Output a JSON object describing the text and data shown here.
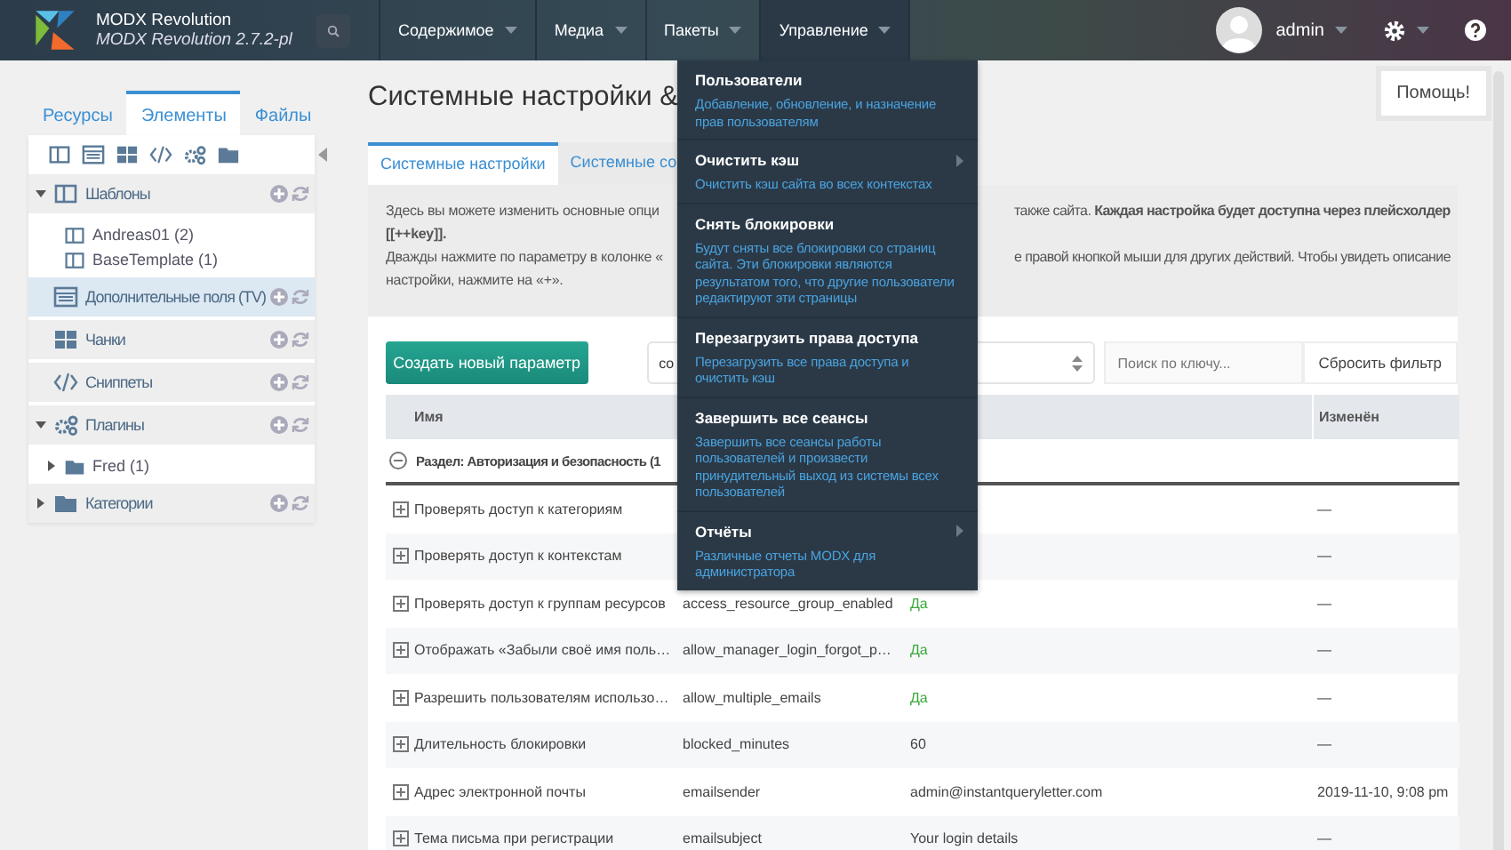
{
  "header": {
    "brand": "MODX Revolution",
    "version": "MODX Revolution 2.7.2-pl",
    "menu": [
      {
        "label": "Содержимое",
        "selected": false
      },
      {
        "label": "Медиа",
        "selected": false
      },
      {
        "label": "Пакеты",
        "selected": false
      },
      {
        "label": "Управление",
        "selected": true
      }
    ],
    "user": "admin"
  },
  "sidebar": {
    "tabs": [
      {
        "label": "Ресурсы",
        "selected": false
      },
      {
        "label": "Элементы",
        "selected": true
      },
      {
        "label": "Файлы",
        "selected": false
      }
    ],
    "tree": [
      {
        "label": "Шаблоны",
        "kind": "template",
        "expanded": true,
        "selected": false,
        "actions": true,
        "children": [
          {
            "label": "Andreas01 (2)",
            "kind": "template"
          },
          {
            "label": "BaseTemplate (1)",
            "kind": "template"
          }
        ]
      },
      {
        "label": "Дополнительные поля (TV)",
        "kind": "tv",
        "selected": true,
        "actions": true
      },
      {
        "label": "Чанки",
        "kind": "chunk",
        "selected": false,
        "actions": true
      },
      {
        "label": "Сниппеты",
        "kind": "snippet",
        "selected": false,
        "actions": true
      },
      {
        "label": "Плагины",
        "kind": "plugin",
        "expanded": true,
        "selected": false,
        "actions": true,
        "children": [
          {
            "label": "Fred (1)",
            "kind": "folder",
            "expanded": false
          }
        ]
      },
      {
        "label": "Категории",
        "kind": "category",
        "expanded": false,
        "selected": false,
        "actions": true
      }
    ]
  },
  "main": {
    "title": "Системные настройки &",
    "help_button": "Помощь!",
    "tabs": [
      {
        "label": "Системные настройки",
        "selected": true
      },
      {
        "label": "Системные со",
        "selected": false
      }
    ],
    "description_left": [
      "Здесь вы можете изменить основные опци",
      "**[[++key]].**",
      "Дважды нажмите по параметру в колонке «",
      "настройки, нажмите на «+»."
    ],
    "description_right": [
      "также сайта. **Каждая настройка будет доступна через плейсхолдер**",
      "е правой кнопкой мыши для других действий. Чтобы увидеть описание"
    ],
    "create_button": "Создать новый параметр",
    "filter_value": "со",
    "search": {
      "placeholder": "Поиск по ключу..."
    },
    "reset_button": "Сбросить фильтр",
    "table": {
      "columns": [
        "Имя",
        "Изменён"
      ],
      "group": "Раздел: Авторизация и безопасность (1",
      "rows": [
        {
          "name": "Проверять доступ к категориям",
          "modified": "—"
        },
        {
          "name": "Проверять доступ к контекстам",
          "modified": "—"
        },
        {
          "name": "Проверять доступ к группам ресурсов",
          "key": "access_resource_group_enabled",
          "value": "Да",
          "kind": "yes",
          "modified": "—"
        },
        {
          "name": "Отображать «Забыли своё имя поль…",
          "key": "allow_manager_login_forgot_p…",
          "value": "Да",
          "kind": "yes",
          "modified": "—"
        },
        {
          "name": "Разрешить пользователям использо…",
          "key": "allow_multiple_emails",
          "value": "Да",
          "kind": "yes",
          "modified": "—"
        },
        {
          "name": "Длительность блокировки",
          "key": "blocked_minutes",
          "value": "60",
          "kind": "text",
          "modified": "—"
        },
        {
          "name": "Адрес электронной почты",
          "key": "emailsender",
          "value": "admin@instantqueryletter.com",
          "kind": "text",
          "modified": "2019-11-10, 9:08 pm"
        },
        {
          "name": "Тема письма при регистрации",
          "key": "emailsubject",
          "value": "Your login details",
          "kind": "text",
          "modified": "—"
        }
      ]
    }
  },
  "dropdown": [
    {
      "title": "Пользователи",
      "description": "Добавление, обновление, и назначение прав пользователям",
      "submenu": false
    },
    {
      "title": "Очистить кэш",
      "description": "Очистить кэш сайта во всех контекстах",
      "submenu": true
    },
    {
      "title": "Снять блокировки",
      "description": "Будут сняты все блокировки со страниц сайта. Эти блокировки являются результатом того, что другие пользователи редактируют эти страницы",
      "submenu": false
    },
    {
      "title": "Перезагрузить права доступа",
      "description": "Перезагрузить все права доступа и очистить кэш",
      "submenu": false
    },
    {
      "title": "Завершить все сеансы",
      "description": "Завершить все сеансы работы пользователей и произвести принудительный выход из системы всех пользователей",
      "submenu": false
    },
    {
      "title": "Отчёты",
      "description": "Различные отчеты MODX для администратора",
      "submenu": true
    }
  ]
}
